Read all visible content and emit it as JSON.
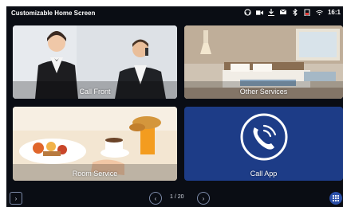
{
  "status_bar": {
    "title": "Customizable Home Screen",
    "time": "16:1",
    "icons": [
      "headset-icon",
      "video-icon",
      "download-icon",
      "message-icon",
      "bluetooth-icon",
      "battery-alert-icon",
      "wifi-icon"
    ]
  },
  "tiles": [
    {
      "label": "Call Front",
      "image": "receptionists-photo"
    },
    {
      "label": "Other Services",
      "image": "hotel-room-photo"
    },
    {
      "label": "Room Service",
      "image": "breakfast-photo"
    },
    {
      "label": "Call App",
      "icon": "phone-call-icon",
      "color": "#1d3c87"
    }
  ],
  "pagination": {
    "text": "1 / 20"
  },
  "colors": {
    "background": "#0a0d14",
    "call_app_tile": "#1d3c87"
  }
}
